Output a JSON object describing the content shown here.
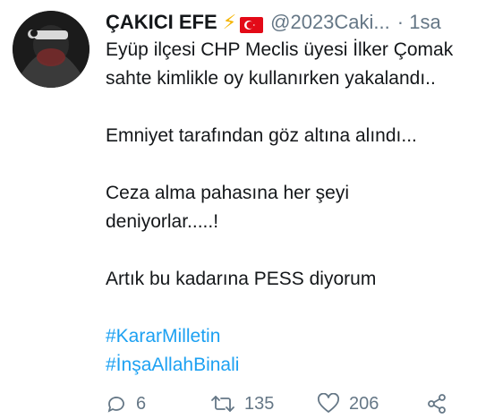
{
  "tweet": {
    "author_name": "ÇAKICI EFE",
    "author_handle": "@2023Caki...",
    "separator": "·",
    "timestamp": "1sa",
    "icons": [
      "high-voltage-icon",
      "turkish-flag-icon"
    ],
    "lines": [
      "Eyüp ilçesi CHP Meclis üyesi İlker Çomak",
      "sahte kimlikle oy kullanırken yakalandı..",
      "",
      "Emniyet tarafından göz altına alındı...",
      "",
      "Ceza alma pahasına her şeyi",
      "deniyorlar.....!",
      "",
      "Artık bu kadarına PESS diyorum",
      ""
    ],
    "hashtags": [
      "#KararMilletin",
      "#İnşaAllahBinali"
    ],
    "stats": {
      "replies": "6",
      "retweets": "135",
      "likes": "206"
    }
  },
  "colors": {
    "text": "#14171a",
    "muted": "#657786",
    "link": "#1da1f2",
    "bolt": "#f4b400",
    "flag": "#e30a17"
  }
}
